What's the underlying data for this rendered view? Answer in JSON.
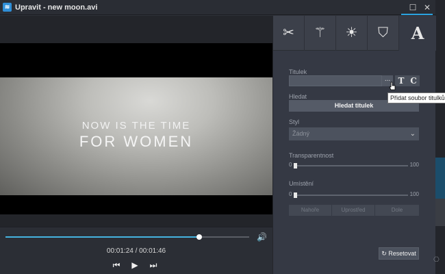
{
  "window": {
    "title": "Upravit - new moon.avi",
    "app_icon_glyph": "≋",
    "maximize_glyph": "☐",
    "close_glyph": "✕"
  },
  "video": {
    "line1": "NOW IS THE TIME",
    "line2": "FOR WOMEN"
  },
  "playback": {
    "progress": 0.795,
    "timecode": "00:01:24 / 00:01:46",
    "volume_icon": "volume-icon",
    "volume_glyph": "🔊",
    "prev_glyph": "⏮",
    "play_glyph": "▶",
    "next_glyph": "⏭"
  },
  "toolbar": {
    "tools": [
      {
        "name": "scissors-icon",
        "glyph": "✂"
      },
      {
        "name": "magic-wand-icon",
        "glyph": "⚚"
      },
      {
        "name": "brightness-icon",
        "glyph": "☀"
      },
      {
        "name": "stamp-icon",
        "glyph": "⛉"
      },
      {
        "name": "text-icon",
        "glyph": "A"
      }
    ]
  },
  "subtitles": {
    "label": "Titulek",
    "value": "",
    "more_glyph": "...",
    "t_button": "T",
    "c_button": "C",
    "tooltip": "Přidat soubor titulků"
  },
  "search": {
    "label": "Hledat",
    "button": "Hledat titulek"
  },
  "style": {
    "label": "Styl",
    "selected": "Žádný",
    "chevron_glyph": "⌄"
  },
  "transparency": {
    "label": "Transparentnost",
    "min": "0",
    "max": "100",
    "value": 0
  },
  "position": {
    "label": "Umístění",
    "min": "0",
    "max": "100",
    "value": 0,
    "buttons": [
      "Nahoře",
      "Uprostřed",
      "Dole"
    ]
  },
  "reset": {
    "label": "Resetovat",
    "glyph": "↻"
  },
  "colors": {
    "accent": "#2aa3e0",
    "seek_fill": "#45b4e0",
    "panel_bg": "#353944"
  }
}
